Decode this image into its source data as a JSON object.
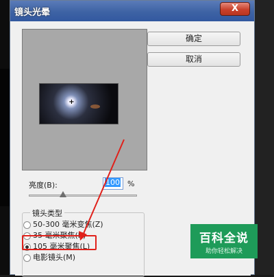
{
  "window": {
    "title": "镜头光晕",
    "close_label": "X"
  },
  "buttons": {
    "ok_label": "确定",
    "cancel_label": "取消"
  },
  "preview": {
    "crosshair": "+"
  },
  "brightness": {
    "label": "亮度(B):",
    "value": "100",
    "unit": "%",
    "slider_level_percent": 30
  },
  "lens_type": {
    "title": "镜头类型",
    "options": [
      {
        "label": "50-300 毫米变焦(Z)",
        "selected": false
      },
      {
        "label": "35 毫米聚焦(K)",
        "selected": false
      },
      {
        "label": "105 毫米聚焦(L)",
        "selected": true
      },
      {
        "label": "电影镜头(M)",
        "selected": false
      }
    ]
  },
  "annotation": {
    "color": "#e0201a"
  },
  "watermark": {
    "title": "百科全说",
    "subtitle": "助你轻松解决",
    "color": "#1e9b59"
  }
}
